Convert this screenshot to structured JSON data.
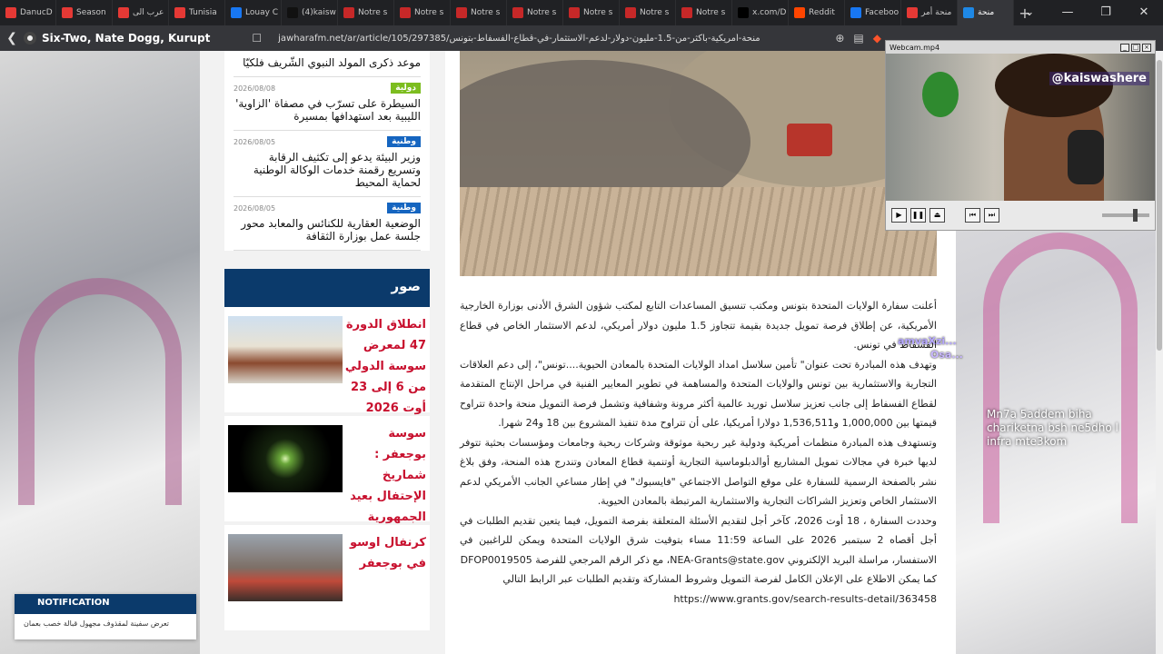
{
  "browser": {
    "tabs": [
      {
        "label": "DanucD",
        "color": "#e53935"
      },
      {
        "label": "Season",
        "color": "#e53935"
      },
      {
        "label": "عرب الى",
        "color": "#e53935"
      },
      {
        "label": "Tunisia",
        "color": "#e53935"
      },
      {
        "label": "Louay C",
        "color": "#1877f2"
      },
      {
        "label": "(4)kaisw",
        "color": "#111111"
      },
      {
        "label": "Notre s",
        "color": "#c62828"
      },
      {
        "label": "Notre s",
        "color": "#c62828"
      },
      {
        "label": "Notre s",
        "color": "#c62828"
      },
      {
        "label": "Notre s",
        "color": "#c62828"
      },
      {
        "label": "Notre s",
        "color": "#c62828"
      },
      {
        "label": "Notre s",
        "color": "#c62828"
      },
      {
        "label": "Notre s",
        "color": "#c62828"
      },
      {
        "label": "x.com/D",
        "color": "#000000"
      },
      {
        "label": "Reddit",
        "color": "#ff4500"
      },
      {
        "label": "Faceboo",
        "color": "#1877f2"
      },
      {
        "label": "منحة أمر",
        "color": "#e53935"
      },
      {
        "label": "منحة",
        "color": "#1e88e5"
      }
    ],
    "new_tab": "+",
    "window_controls": [
      "⌄",
      "—",
      "❐",
      "✕"
    ],
    "media_title": "Six-Two, Nate Dogg, Kurupt",
    "url": "jawharafm.net/ar/article/105/297385/منحة-أمريكية-بأكثر-من-1.5-مليون-دولار-لدعم-الاستثمار-في-قطاع-الفسفاط-بتونس"
  },
  "sidebar": {
    "news": [
      {
        "date": "",
        "badge": "",
        "badge_color": "#ffffff",
        "title": "موعد ذكرى المولد النبوي الشّريف فلكيّا"
      },
      {
        "date": "2026/08/08",
        "badge": "دولية",
        "badge_color": "#7cbd1f",
        "title": "السيطرة على تسرّب في مصفاة 'الزاوية' الليبية بعد استهدافها بمسيرة"
      },
      {
        "date": "2026/08/05",
        "badge": "وطنية",
        "badge_color": "#1565c0",
        "title": "وزير البيئة يدعو إلى تكثيف الرقابة وتسريع رقمنة خدمات الوكالة الوطنية لحماية المحيط"
      },
      {
        "date": "2026/08/05",
        "badge": "وطنية",
        "badge_color": "#1565c0",
        "title": "الوضعية العقارية للكنائس والمعابد محور جلسة عمل بوزارة الثقافة"
      }
    ],
    "photos_heading": "صور",
    "photos": [
      {
        "caption": "انطلاق الدورة 47 لمعرض سوسة الدولي من 6 إلى 23 أوت 2026"
      },
      {
        "caption": "سوسة بوجعفر : شماريخ الإحتفال بعيد الجمهورية"
      },
      {
        "caption": "كرنفال اوسو في بوجعفر"
      }
    ]
  },
  "article": {
    "paragraphs": [
      "أعلنت سفارة الولايات المتحدة بتونس ومكتب تنسيق المساعدات التابع لمكتب شؤون الشرق الأدنى بوزارة الخارجية الأمريكية، عن إطلاق فرصة تمويل جديدة بقيمة تتجاوز 1.5 مليون دولار أمريكي، لدعم الاستثمار الخاص في قطاع الفسفاط في تونس.",
      "وتهدف هذه المبادرة تحت عنوان\" تأمين سلاسل امداد الولايات المتحدة بالمعادن الحيوية....تونس\"، إلى دعم العلاقات التجارية والاستثمارية بين تونس والولايات المتحدة والمساهمة في تطوير المعايير الفنية في مراحل الإنتاج المتقدمة لقطاع الفسفاط إلى جانب تعزيز سلاسل توريد عالمية أكثر مرونة وشفافية وتشمل فرصة التمويل منحة واحدة تتراوح قيمتها بين 1,000,000 و1,536,511 دولارا أمريكيا، على أن تتراوح مدة تنفيذ المشروع بين 18 و24 شهرا.",
      "وتستهدف هذه المبادرة منظمات أمريكية ودولية غير ربحية موثوقة وشركات ربحية وجامعات ومؤسسات بحثية تتوفر لديها خبرة في مجالات تمويل المشاريع أوالدبلوماسية التجارية أوتنمية قطاع المعادن وتندرج هذه المنحة، وفق بلاغ نشر بالصفحة الرسمية للسفارة على موقع التواصل الاجتماعي \"فايسبوك\" في إطار مساعي الجانب الأمريكي لدعم الاستثمار الخاص وتعزيز الشراكات التجارية والاستثمارية المرتبطة بالمعادن الحيوية.",
      "وحددت السفارة ، 18 أوت 2026، كآخر أجل لتقديم الأسئلة المتعلقة بفرصة التمويل، فيما يتعين تقديم الطلبات في أجل أقصاه 2 سبتمبر 2026 على الساعة 11:59 مساء بتوقيت شرق الولايات المتحدة ويمكن للراغبين في الاستفسار، مراسلة البريد الإلكتروني NEA-Grants@state.gov، مع ذكر الرقم المرجعي للفرصة DFOP0019505",
      "كما يمكن الاطلاع على الإعلان الكامل لفرصة التمويل وشروط المشاركة وتقديم الطلبات عبر الرابط التالي"
    ],
    "link": "https://www.grants.gov/search-results-detail/363458"
  },
  "notification": {
    "heading": "NOTIFICATION",
    "text": "تعرض سفينة لمقذوف مجهول قبالة خصب بعمان"
  },
  "webcam": {
    "title": "Webcam.mp4",
    "handle": "@kaiswashere"
  },
  "chat": {
    "user1": "amvaXzi...",
    "user2": "Osa...",
    "message": "Mn7a 5addem biha chariketna bsh ne5dho l infra mte3kom"
  }
}
